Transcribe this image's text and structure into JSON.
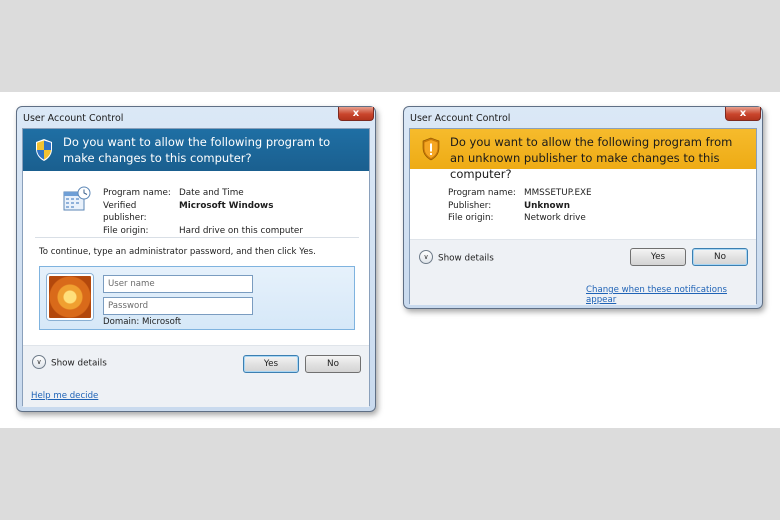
{
  "left_dialog": {
    "title": "User Account Control",
    "close_symbol": "x",
    "banner_color": "#1d6698",
    "question": "Do you want to allow the following program to make changes to this computer?",
    "program_icon": "calendar-clock-icon",
    "fields": [
      {
        "label": "Program name:",
        "value": "Date and Time"
      },
      {
        "label": "Verified publisher:",
        "value": "Microsoft Windows"
      },
      {
        "label": "File origin:",
        "value": "Hard drive on this computer"
      }
    ],
    "instruction": "To continue, type an administrator password, and then click Yes.",
    "username_placeholder": "User name",
    "password_placeholder": "Password",
    "domain": "Domain: Microsoft",
    "show_details": "Show details",
    "yes_label": "Yes",
    "no_label": "No",
    "help_link": "Help me decide"
  },
  "right_dialog": {
    "title": "User Account Control",
    "close_symbol": "x",
    "banner_color": "#f2b11f",
    "question": "Do you want to allow the following program from an unknown publisher to make changes to this computer?",
    "fields": [
      {
        "label": "Program name:",
        "value": "MMSSETUP.EXE"
      },
      {
        "label": "Publisher:",
        "value": "Unknown"
      },
      {
        "label": "File origin:",
        "value": "Network drive"
      }
    ],
    "show_details": "Show details",
    "yes_label": "Yes",
    "no_label": "No",
    "notifications_link": "Change when these notifications appear"
  }
}
